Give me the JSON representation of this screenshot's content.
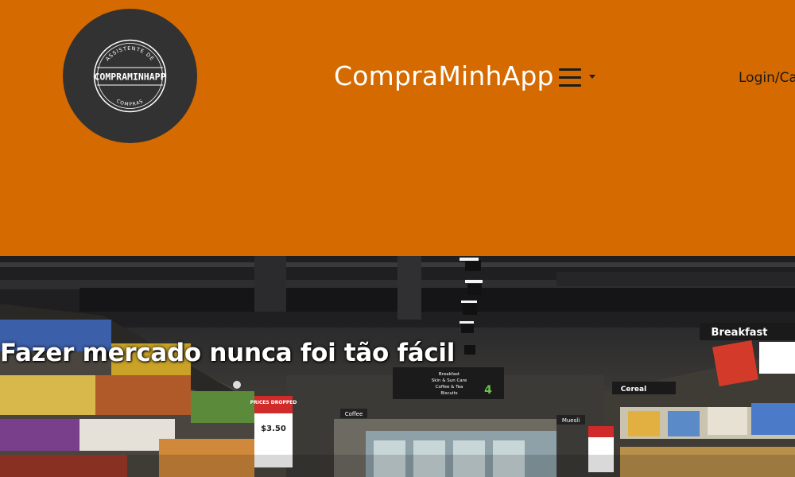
{
  "header": {
    "logo": {
      "top_text": "ASSISTENTE DE",
      "name": "COMPRAMINHAPP",
      "bottom_text": "COMPRAS"
    },
    "brand_title": "CompraMinhApp",
    "menu_icon": "hamburger-icon",
    "login_label": "Login/Ca",
    "colors": {
      "background": "#d46a00",
      "logo_bg": "#323232",
      "title": "#ffffff"
    }
  },
  "hero": {
    "heading": "Fazer mercado nunca foi tão fácil",
    "signs": {
      "breakfast": "Breakfast",
      "aisle_list": [
        "Breakfast",
        "Skin & Sun Care",
        "Coffee & Tea",
        "Biscuits"
      ],
      "aisle_number": "4",
      "cereal": "Cereal",
      "coffee": "Coffee",
      "muesli": "Muesli",
      "prices_dropped": "PRICES DROPPED",
      "price_main": "$3.50"
    }
  }
}
